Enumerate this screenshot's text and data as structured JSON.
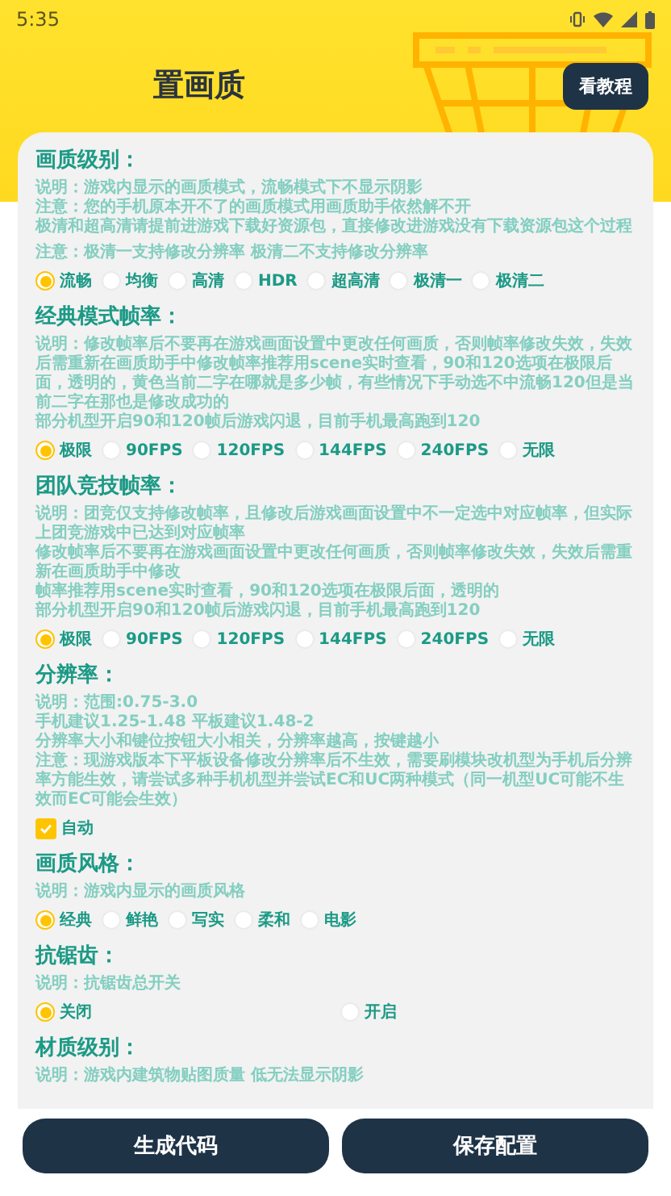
{
  "status_bar": {
    "time": "5:35"
  },
  "header": {
    "title": "置画质",
    "tutorial_button": "看教程"
  },
  "sections": [
    {
      "kind": "radio",
      "title": "画质级别：",
      "description": [
        "说明：游戏内显示的画质模式，流畅模式下不显示阴影",
        "注意：您的手机原本开不了的画质模式用画质助手依然解不开",
        "极清和超高清请提前进游戏下载好资源包，直接修改进游戏没有下载资源包这个过程"
      ],
      "note": "注意：极清一支持修改分辨率 极清二不支持修改分辨率",
      "options": [
        {
          "label": "流畅",
          "selected": true
        },
        {
          "label": "均衡",
          "selected": false
        },
        {
          "label": "高清",
          "selected": false
        },
        {
          "label": "HDR",
          "selected": false
        },
        {
          "label": "超高清",
          "selected": false
        },
        {
          "label": "极清一",
          "selected": false
        },
        {
          "label": "极清二",
          "selected": false
        }
      ]
    },
    {
      "kind": "radio",
      "title": "经典模式帧率：",
      "description": [
        "说明：修改帧率后不要再在游戏画面设置中更改任何画质，否则帧率修改失效，失效后需重新在画质助手中修改帧率推荐用scene实时查看，90和120选项在极限后面，透明的，黄色当前二字在哪就是多少帧，有些情况下手动选不中流畅120但是当前二字在那也是修改成功的",
        "部分机型开启90和120帧后游戏闪退，目前手机最高跑到120"
      ],
      "options": [
        {
          "label": "极限",
          "selected": true
        },
        {
          "label": "90FPS",
          "selected": false
        },
        {
          "label": "120FPS",
          "selected": false
        },
        {
          "label": "144FPS",
          "selected": false
        },
        {
          "label": "240FPS",
          "selected": false
        },
        {
          "label": "无限",
          "selected": false
        }
      ]
    },
    {
      "kind": "radio",
      "title": "团队竞技帧率：",
      "description": [
        "说明：团竞仅支持修改帧率，且修改后游戏画面设置中不一定选中对应帧率，但实际上团竞游戏中已达到对应帧率",
        "修改帧率后不要再在游戏画面设置中更改任何画质，否则帧率修改失效，失效后需重新在画质助手中修改",
        "帧率推荐用scene实时查看，90和120选项在极限后面，透明的",
        "部分机型开启90和120帧后游戏闪退，目前手机最高跑到120"
      ],
      "options": [
        {
          "label": "极限",
          "selected": true
        },
        {
          "label": "90FPS",
          "selected": false
        },
        {
          "label": "120FPS",
          "selected": false
        },
        {
          "label": "144FPS",
          "selected": false
        },
        {
          "label": "240FPS",
          "selected": false
        },
        {
          "label": "无限",
          "selected": false
        }
      ]
    },
    {
      "kind": "checkbox",
      "title": "分辨率：",
      "description": [
        "说明：范围:0.75-3.0",
        "手机建议1.25-1.48  平板建议1.48-2",
        "分辨率大小和键位按钮大小相关，分辨率越高，按键越小",
        "注意：现游戏版本下平板设备修改分辨率后不生效，需要刷模块改机型为手机后分辨率方能生效，请尝试多种手机机型并尝试EC和UC两种模式（同一机型UC可能不生效而EC可能会生效）"
      ],
      "options": [
        {
          "label": "自动",
          "checked": true
        }
      ]
    },
    {
      "kind": "radio",
      "title": "画质风格：",
      "description": [
        "说明：游戏内显示的画质风格"
      ],
      "options": [
        {
          "label": "经典",
          "selected": true
        },
        {
          "label": "鲜艳",
          "selected": false
        },
        {
          "label": "写实",
          "selected": false
        },
        {
          "label": "柔和",
          "selected": false
        },
        {
          "label": "电影",
          "selected": false
        }
      ]
    },
    {
      "kind": "radio",
      "title": "抗锯齿：",
      "description": [
        "说明：抗锯齿总开关"
      ],
      "options": [
        {
          "label": "关闭",
          "selected": true
        },
        {
          "label": "开启",
          "selected": false
        }
      ]
    },
    {
      "kind": "info",
      "title": "材质级别：",
      "description": [
        "说明：游戏内建筑物贴图质量 低无法显示阴影"
      ]
    }
  ],
  "buttons": [
    "生成代码",
    "保存配置"
  ]
}
